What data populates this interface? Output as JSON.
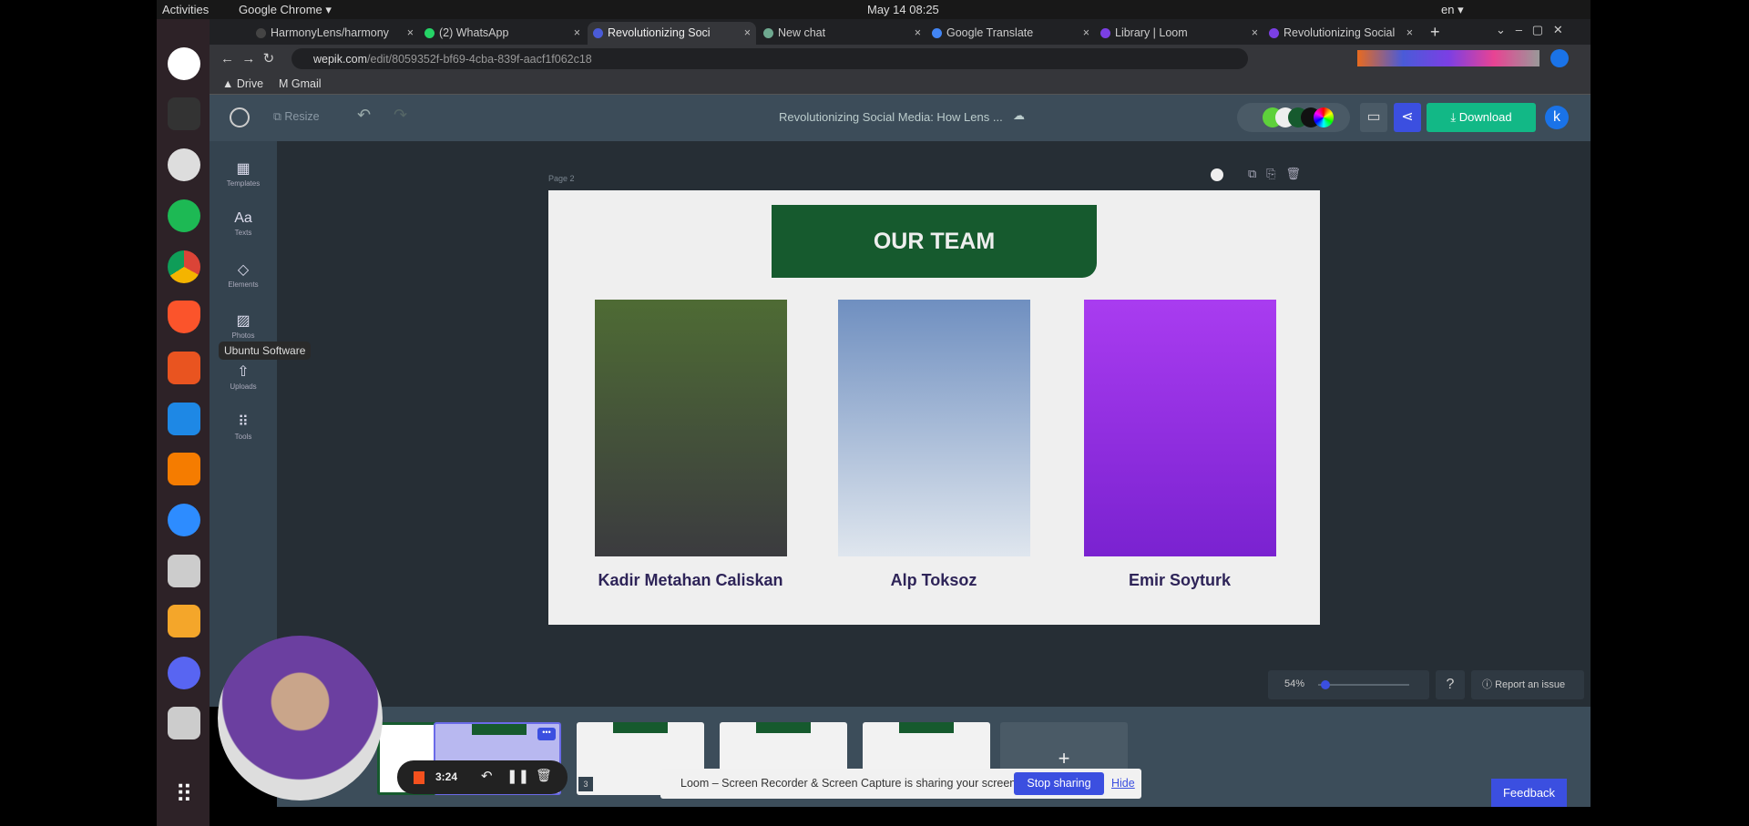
{
  "system": {
    "activities": "Activities",
    "app_menu": "Google Chrome ▾",
    "clock": "May 14  08:25",
    "lang": "en ▾",
    "tooltip": "Ubuntu Software"
  },
  "tabs": [
    {
      "label": "HarmonyLens/harmony",
      "color": "#444"
    },
    {
      "label": "(2) WhatsApp",
      "color": "#25d366"
    },
    {
      "label": "Revolutionizing Soci",
      "color": "#4a5bd8",
      "active": true
    },
    {
      "label": "New chat",
      "color": "#6ea88f"
    },
    {
      "label": "Google Translate",
      "color": "#4285f4"
    },
    {
      "label": "Library | Loom",
      "color": "#7b3fe4"
    },
    {
      "label": "Revolutionizing Social",
      "color": "#7b3fe4"
    }
  ],
  "address": {
    "domain": "wepik.com",
    "path": "/edit/8059352f-bf69-4cba-839f-aacf1f062c18"
  },
  "bookmarks": [
    "Drive",
    "Gmail"
  ],
  "editor": {
    "resize": "Resize",
    "doc_title": "Revolutionizing Social Media: How Lens ...",
    "download": "Download",
    "avatar": "k",
    "page_label": "Page 2"
  },
  "sidebar": [
    {
      "label": "Templates",
      "icon": "▦"
    },
    {
      "label": "Texts",
      "icon": "Aa"
    },
    {
      "label": "Elements",
      "icon": "◇"
    },
    {
      "label": "Photos",
      "icon": "▨"
    },
    {
      "label": "Uploads",
      "icon": "⇧"
    },
    {
      "label": "Tools",
      "icon": "⠿"
    }
  ],
  "slide": {
    "title": "OUR TEAM",
    "members": [
      {
        "name": "Kadir Metahan Caliskan",
        "photo_colors": [
          "#4e6b34",
          "#3b3b3f"
        ]
      },
      {
        "name": "Alp Toksoz",
        "photo_colors": [
          "#6f8fc0",
          "#dfe6ee"
        ]
      },
      {
        "name": "Emir Soyturk",
        "photo_colors": [
          "#a93cf0",
          "#7a22d0"
        ]
      }
    ]
  },
  "zoom": {
    "value": "54%",
    "level": 54
  },
  "report": "Report an issue",
  "thumb_number": "3",
  "recorder": {
    "time": "3:24"
  },
  "loom": {
    "message": "Loom – Screen Recorder & Screen Capture is sharing your screen.",
    "stop": "Stop sharing",
    "hide": "Hide"
  },
  "feedback": "Feedback",
  "colors": {
    "green": "#165a2e",
    "download": "#12b886",
    "accent": "#3b4fe0"
  }
}
